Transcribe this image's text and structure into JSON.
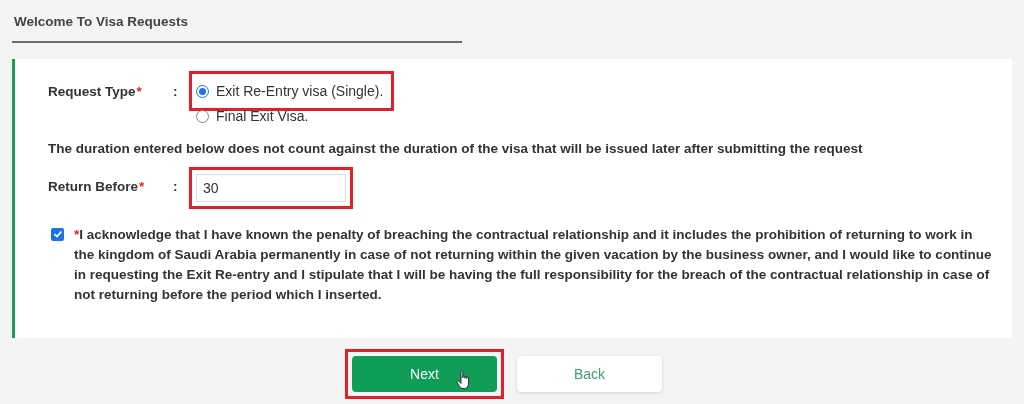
{
  "header": {
    "title": "Welcome To Visa Requests"
  },
  "form": {
    "request_type": {
      "label": "Request Type",
      "required_mark": "*",
      "separator": ":",
      "options": [
        {
          "label": "Exit Re-Entry visa (Single).",
          "selected": true,
          "highlighted": true
        },
        {
          "label": "Final Exit Visa.",
          "selected": false,
          "highlighted": false
        }
      ]
    },
    "note": "The duration entered below does not count against the duration of the visa that will be issued later after submitting the request",
    "return_before": {
      "label": "Return Before",
      "required_mark": "*",
      "separator": ":",
      "value": "30",
      "highlighted": true
    },
    "acknowledge": {
      "checked": true,
      "required_mark": "*",
      "text": "I acknowledge that I have known the penalty of breaching the contractual relationship and it includes the prohibition of returning to work in the kingdom of Saudi Arabia permanently in case of not returning within the given vacation by the business owner, and I would like to continue in requesting the Exit Re-entry and I stipulate that I will be having the full responsibility for the breach of the contractual relationship in case of not returning before the period which I inserted."
    }
  },
  "buttons": [
    {
      "label": "Next",
      "kind": "primary",
      "highlighted": true,
      "pointer": true
    },
    {
      "label": "Back",
      "kind": "secondary",
      "highlighted": false,
      "pointer": false
    }
  ]
}
